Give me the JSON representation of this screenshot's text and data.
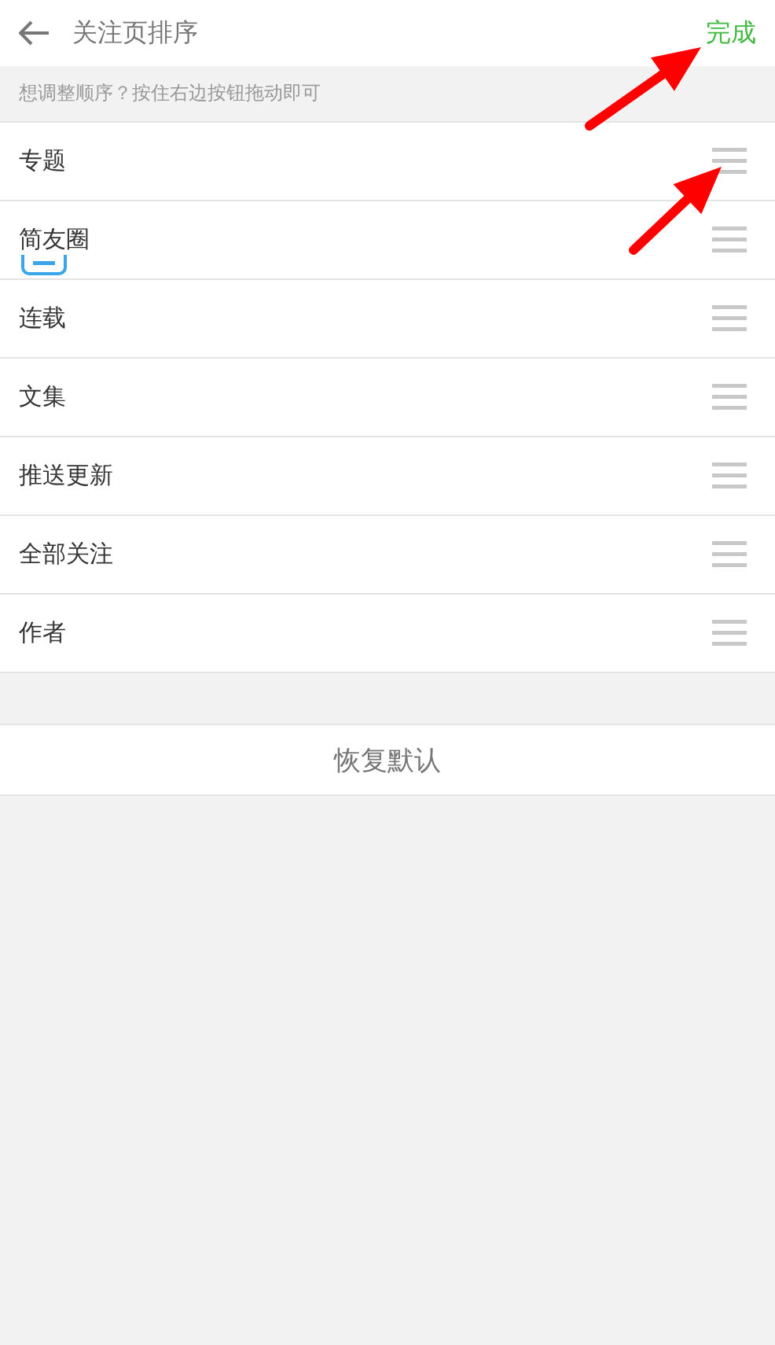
{
  "header": {
    "title": "关注页排序",
    "action": "完成"
  },
  "hint": "想调整顺序？按住右边按钮拖动即可",
  "items": [
    {
      "label": "专题"
    },
    {
      "label": "简友圈"
    },
    {
      "label": "连载"
    },
    {
      "label": "文集"
    },
    {
      "label": "推送更新"
    },
    {
      "label": "全部关注"
    },
    {
      "label": "作者"
    }
  ],
  "reset_button": "恢复默认"
}
